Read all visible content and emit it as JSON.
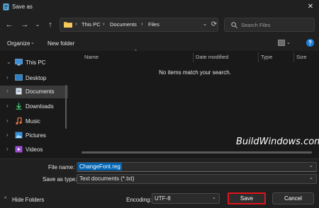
{
  "window": {
    "title": "Save as",
    "close_glyph": "✕"
  },
  "nav": {
    "back_glyph": "←",
    "forward_glyph": "→",
    "dropdown_glyph": "⌄",
    "up_glyph": "↑",
    "refresh_glyph": "⟳"
  },
  "address": {
    "crumbs": [
      "This PC",
      "Documents",
      "Files"
    ],
    "separator": "›"
  },
  "search": {
    "placeholder": "Search Files"
  },
  "toolbar": {
    "organize_label": "Organize",
    "new_folder_label": "New folder",
    "help_glyph": "?"
  },
  "sidebar": {
    "items": [
      {
        "label": "This PC",
        "icon": "computer-icon",
        "expanded": true
      },
      {
        "label": "Desktop",
        "icon": "desktop-icon"
      },
      {
        "label": "Documents",
        "icon": "documents-icon",
        "selected": true
      },
      {
        "label": "Downloads",
        "icon": "download-icon"
      },
      {
        "label": "Music",
        "icon": "music-icon"
      },
      {
        "label": "Pictures",
        "icon": "pictures-icon"
      },
      {
        "label": "Videos",
        "icon": "videos-icon"
      }
    ]
  },
  "columns": [
    "Name",
    "Date modified",
    "Type",
    "Size"
  ],
  "empty_message": "No items match your search.",
  "watermark": "BuildWindows.com",
  "form": {
    "file_name_label": "File name:",
    "file_name_value": "ChangeFont.reg",
    "save_as_type_label": "Save as type:",
    "save_as_type_value": "Text documents (*.txt)",
    "encoding_label": "Encoding:",
    "encoding_value": "UTF-8"
  },
  "footer": {
    "hide_folders_label": "Hide Folders",
    "save_label": "Save",
    "cancel_label": "Cancel"
  },
  "colors": {
    "accent": "#0063b1",
    "highlight_border": "#e0141b",
    "background": "#1c1c1c"
  }
}
